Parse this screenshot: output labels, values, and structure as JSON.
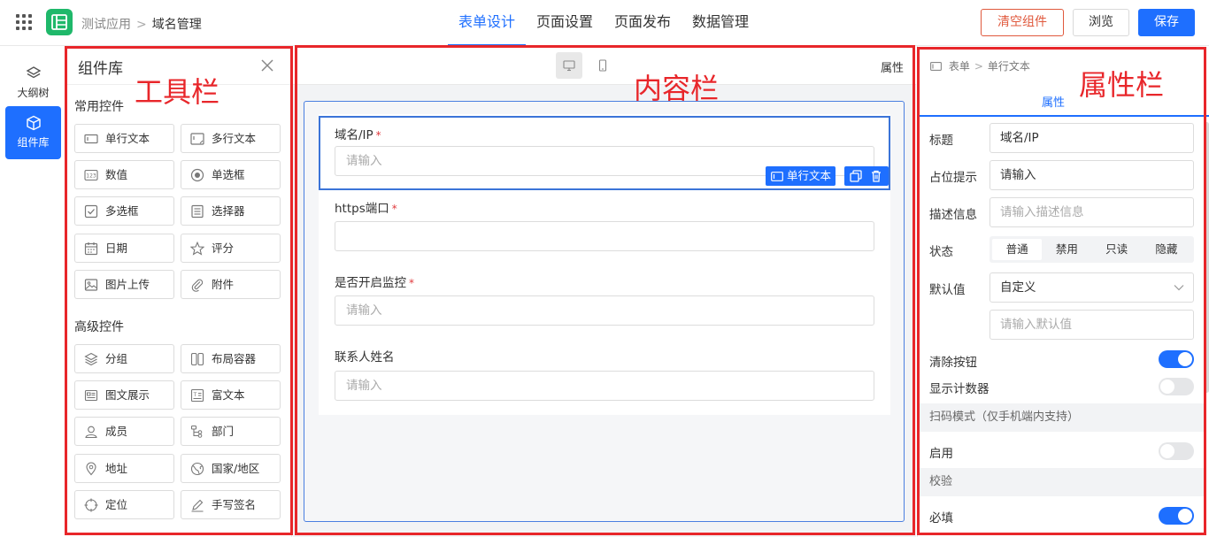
{
  "app": {
    "breadcrumb": [
      "测试应用",
      "域名管理"
    ],
    "separator": ">"
  },
  "top_tabs": [
    {
      "label": "表单设计",
      "active": true
    },
    {
      "label": "页面设置",
      "active": false
    },
    {
      "label": "页面发布",
      "active": false
    },
    {
      "label": "数据管理",
      "active": false
    }
  ],
  "actions": {
    "clear": "清空组件",
    "preview": "浏览",
    "save": "保存"
  },
  "left_nav": [
    {
      "label": "大纲树",
      "icon": "layers-icon",
      "active": false
    },
    {
      "label": "组件库",
      "icon": "cube-icon",
      "active": true
    }
  ],
  "library": {
    "title": "组件库",
    "sections": [
      {
        "title": "常用控件",
        "items": [
          {
            "label": "单行文本",
            "icon": "single-line-icon"
          },
          {
            "label": "多行文本",
            "icon": "multi-line-icon"
          },
          {
            "label": "数值",
            "icon": "number-icon"
          },
          {
            "label": "单选框",
            "icon": "radio-icon"
          },
          {
            "label": "多选框",
            "icon": "checkbox-icon"
          },
          {
            "label": "选择器",
            "icon": "select-icon"
          },
          {
            "label": "日期",
            "icon": "calendar-icon"
          },
          {
            "label": "评分",
            "icon": "star-icon"
          },
          {
            "label": "图片上传",
            "icon": "image-icon"
          },
          {
            "label": "附件",
            "icon": "paperclip-icon"
          }
        ]
      },
      {
        "title": "高级控件",
        "items": [
          {
            "label": "分组",
            "icon": "layers-icon"
          },
          {
            "label": "布局容器",
            "icon": "columns-icon"
          },
          {
            "label": "图文展示",
            "icon": "card-icon"
          },
          {
            "label": "富文本",
            "icon": "richtext-icon"
          },
          {
            "label": "成员",
            "icon": "user-icon"
          },
          {
            "label": "部门",
            "icon": "tree-icon"
          },
          {
            "label": "地址",
            "icon": "location-icon"
          },
          {
            "label": "国家/地区",
            "icon": "globe-icon"
          },
          {
            "label": "定位",
            "icon": "crosshair-icon"
          },
          {
            "label": "手写签名",
            "icon": "pen-icon"
          }
        ]
      }
    ]
  },
  "canvas": {
    "attr_link": "属性",
    "fields": [
      {
        "label": "域名/IP",
        "required": true,
        "placeholder": "请输入",
        "selected": true
      },
      {
        "label": "https端口",
        "required": true,
        "placeholder": "",
        "selected": false
      },
      {
        "label": "是否开启监控",
        "required": true,
        "placeholder": "请输入",
        "selected": false
      },
      {
        "label": "联系人姓名",
        "required": false,
        "placeholder": "请输入",
        "selected": false
      }
    ],
    "selected_badge": "单行文本"
  },
  "properties": {
    "breadcrumb": [
      "表单",
      "单行文本"
    ],
    "tab": "属性",
    "title_label": "标题",
    "title_value": "域名/IP",
    "placeholder_label": "占位提示",
    "placeholder_value": "请输入",
    "desc_label": "描述信息",
    "desc_placeholder": "请输入描述信息",
    "state_label": "状态",
    "state_options": [
      "普通",
      "禁用",
      "只读",
      "隐藏"
    ],
    "state_selected": "普通",
    "default_label": "默认值",
    "default_mode": "自定义",
    "default_placeholder": "请输入默认值",
    "clear_btn_label": "清除按钮",
    "clear_btn_on": true,
    "counter_label": "显示计数器",
    "counter_on": false,
    "scan_section": "扫码模式（仅手机端内支持）",
    "scan_enable_label": "启用",
    "scan_enable_on": false,
    "validate_section": "校验",
    "required_label": "必填",
    "required_on": true
  },
  "annotations": {
    "toolbar": "工具栏",
    "content": "内容栏",
    "props": "属性栏"
  },
  "colors": {
    "primary": "#1e6fff",
    "danger": "#e0593d",
    "annotation": "#e8262a",
    "logo": "#1fb86a"
  }
}
